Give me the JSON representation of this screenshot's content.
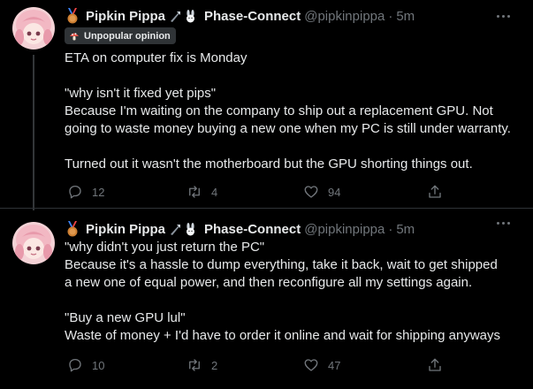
{
  "tweets": [
    {
      "author_name": "Pipkin Pippa",
      "affiliation": "Phase-Connect",
      "handle": "@pipkinpippa",
      "separator": "·",
      "time": "5m",
      "badge": "Unpopular opinion",
      "lines": [
        "ETA on computer fix is Monday",
        "",
        "\"why isn't it fixed yet pips\"",
        "Because I'm waiting on the company to ship out a replacement GPU. Not",
        "going to waste money buying a new one when my PC is still under warranty.",
        "",
        "Turned out it wasn't the motherboard but the GPU shorting things out."
      ],
      "replies": "12",
      "retweets": "4",
      "likes": "94"
    },
    {
      "author_name": "Pipkin Pippa",
      "affiliation": "Phase-Connect",
      "handle": "@pipkinpippa",
      "separator": "·",
      "time": "5m",
      "lines": [
        "\"why didn't you just return the PC\"",
        "Because it's a hassle to dump everything, take it back, wait to get shipped",
        "a new one of equal power, and then reconfigure all my settings again.",
        "",
        "\"Buy a new GPU lul\"",
        "Waste of money + I'd have to order it online and wait for shipping anyways"
      ],
      "replies": "10",
      "retweets": "2",
      "likes": "47"
    }
  ],
  "icons": {
    "medal": "bronze-medal-icon",
    "affiliation_logo": "phase-connect-logo-icon",
    "bunny": "bunny-icon",
    "badge": "mushroom-icon",
    "reply": "reply-icon",
    "retweet": "retweet-icon",
    "like": "heart-icon",
    "share": "share-icon",
    "more": "more-icon"
  },
  "colors": {
    "background": "#000000",
    "text": "#e7e9ea",
    "secondary": "#71767b",
    "badge_bg": "#2f3336",
    "divider": "#2f3336"
  }
}
